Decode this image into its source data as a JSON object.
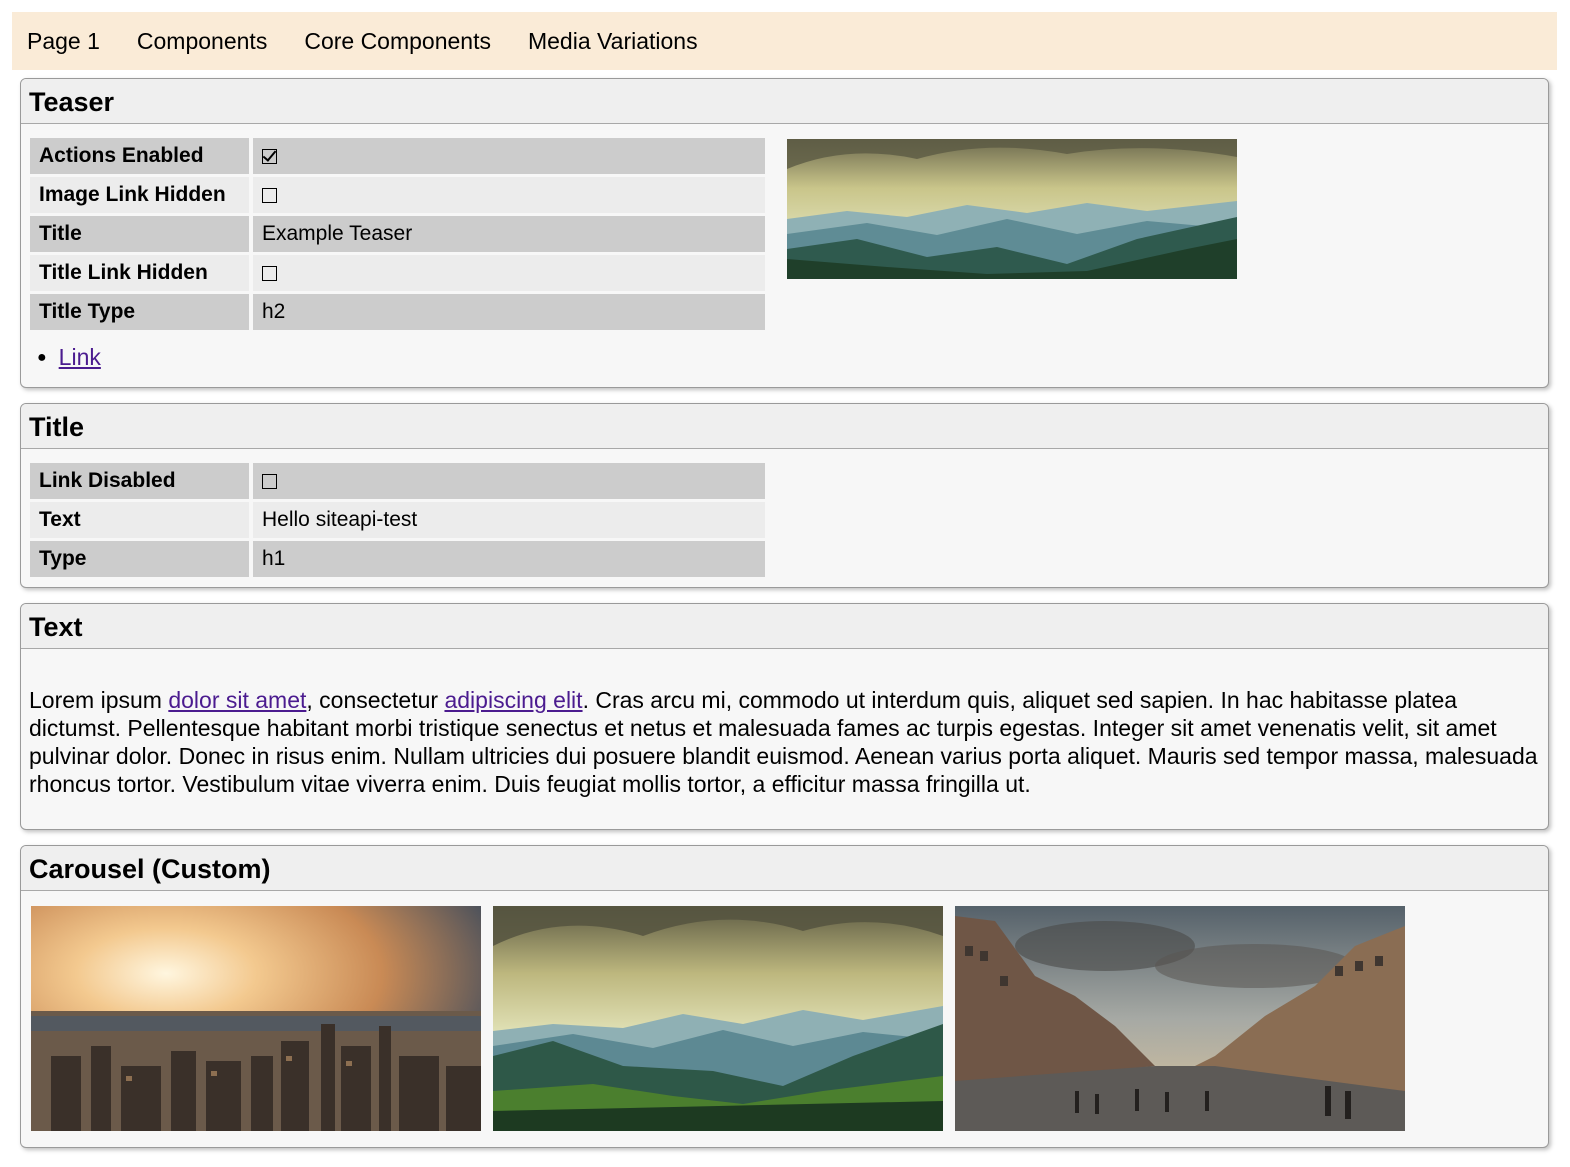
{
  "nav": [
    "Page 1",
    "Components",
    "Core Components",
    "Media Variations"
  ],
  "teaser": {
    "heading": "Teaser",
    "props": [
      {
        "key": "Actions Enabled",
        "checked": true
      },
      {
        "key": "Image Link Hidden",
        "checked": false
      },
      {
        "key": "Title",
        "value": "Example Teaser"
      },
      {
        "key": "Title Link Hidden",
        "checked": false
      },
      {
        "key": "Title Type",
        "value": "h2"
      }
    ],
    "link_label": "Link",
    "image_icon": "mountain-landscape-image"
  },
  "title": {
    "heading": "Title",
    "props": [
      {
        "key": "Link Disabled",
        "checked": false
      },
      {
        "key": "Text",
        "value": "Hello siteapi-test"
      },
      {
        "key": "Type",
        "value": "h1"
      }
    ]
  },
  "text": {
    "heading": "Text",
    "before_link1": "Lorem ipsum ",
    "link1": "dolor sit amet",
    "between": ", consectetur ",
    "link2": "adipiscing elit",
    "after": ". Cras arcu mi, commodo ut interdum quis, aliquet sed sapien. In hac habitasse platea dictumst. Pellentesque habitant morbi tristique senectus et netus et malesuada fames ac turpis egestas. Integer sit amet venenatis velit, sit amet pulvinar dolor. Donec in risus enim. Nullam ultricies dui posuere blandit euismod. Aenean varius porta aliquet. Mauris sed tempor massa, malesuada rhoncus tortor. Vestibulum vitae viverra enim. Duis feugiat mollis tortor, a efficitur massa fringilla ut."
  },
  "carousel": {
    "heading": "Carousel (Custom)",
    "images": [
      "city-skyline-sunset-image",
      "mountain-landscape-image",
      "city-street-plaza-image"
    ]
  },
  "colors": {
    "nav_bg": "#faebd7",
    "link": "#4b1b8f",
    "panel_bg": "#f7f7f7",
    "row_dark": "#cccccc",
    "row_light": "#ececec"
  }
}
